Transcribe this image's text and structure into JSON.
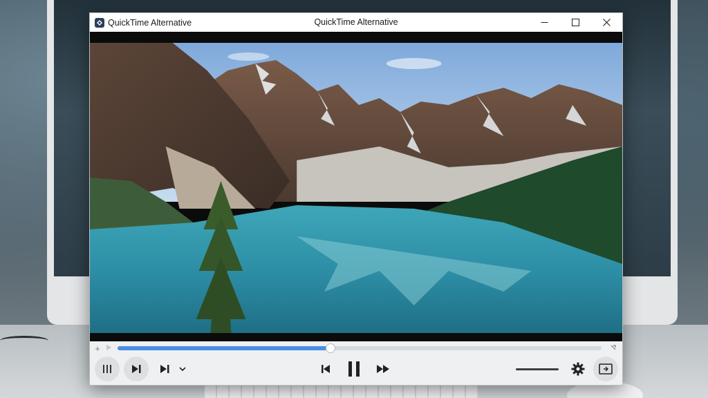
{
  "window": {
    "app_name": "QuickTime Alternative",
    "title": "QuickTime Alternative",
    "controls": [
      "minimize-icon",
      "maximize-icon",
      "close-icon"
    ]
  },
  "video": {
    "description_icon": "video-frame"
  },
  "playback": {
    "progress_fraction": 0.44,
    "seek_left_icon": "plus-icon",
    "seek_right_icon": "expand-icon",
    "volume_fraction": 1.0,
    "buttons": {
      "left": [
        "playlist-icon",
        "next-frame-icon",
        "skip-forward-icon",
        "chevron-down-icon"
      ],
      "center": [
        "skip-previous-icon",
        "pause-icon",
        "fast-forward-icon"
      ],
      "right": [
        "settings-icon",
        "screen-cast-icon"
      ]
    }
  },
  "colors": {
    "accent": "#4a90e2",
    "titlebar": "#ffffff",
    "controls_bg": "#eef0f2"
  }
}
